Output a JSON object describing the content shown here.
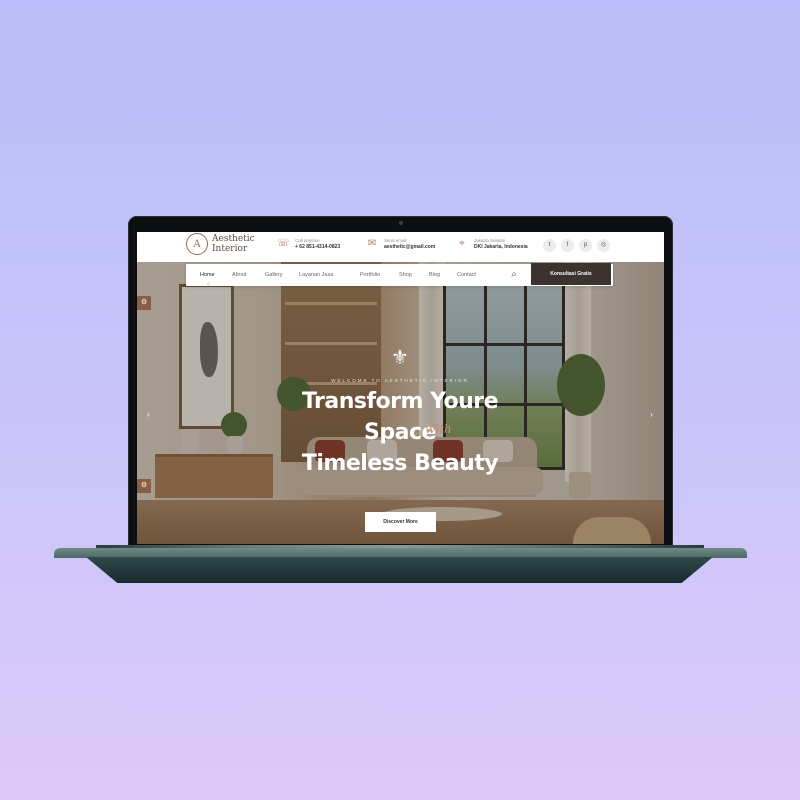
{
  "brand": {
    "logo_letter": "A",
    "name_line1": "Aesthetic",
    "name_line2": "Interior"
  },
  "contacts": [
    {
      "icon": "phone-icon",
      "label": "Call anytime",
      "value": "+ 62 851-4314-0823"
    },
    {
      "icon": "mail-icon",
      "label": "Send email",
      "value": "aesthetic@gmail.com"
    },
    {
      "icon": "location-icon",
      "label": "Jakarta Selatan",
      "value": "DKI Jakarta, Indonesia"
    }
  ],
  "socials": [
    "twitter-icon",
    "facebook-icon",
    "pinterest-icon",
    "instagram-icon"
  ],
  "nav": {
    "items": [
      "Home",
      "About",
      "Gallery",
      "Layanan Jasa",
      "Portfolio",
      "Shop",
      "Blog",
      "Contact"
    ],
    "active": "Home",
    "cta_label": "Konsultasi Gratis"
  },
  "hero": {
    "eyebrow": "WELCOME TO AESTHETIC INTERIOR",
    "title_line1": "Transform Youre",
    "title_line2": "Space",
    "script_text": "with",
    "title_line3": "Timeless Beauty",
    "button_label": "Discover More"
  },
  "colors": {
    "accent": "#b07a5c",
    "cta_bg": "#3c3331",
    "side_tab": "#8a5d46",
    "laptop_base": "#2f4a4c"
  }
}
